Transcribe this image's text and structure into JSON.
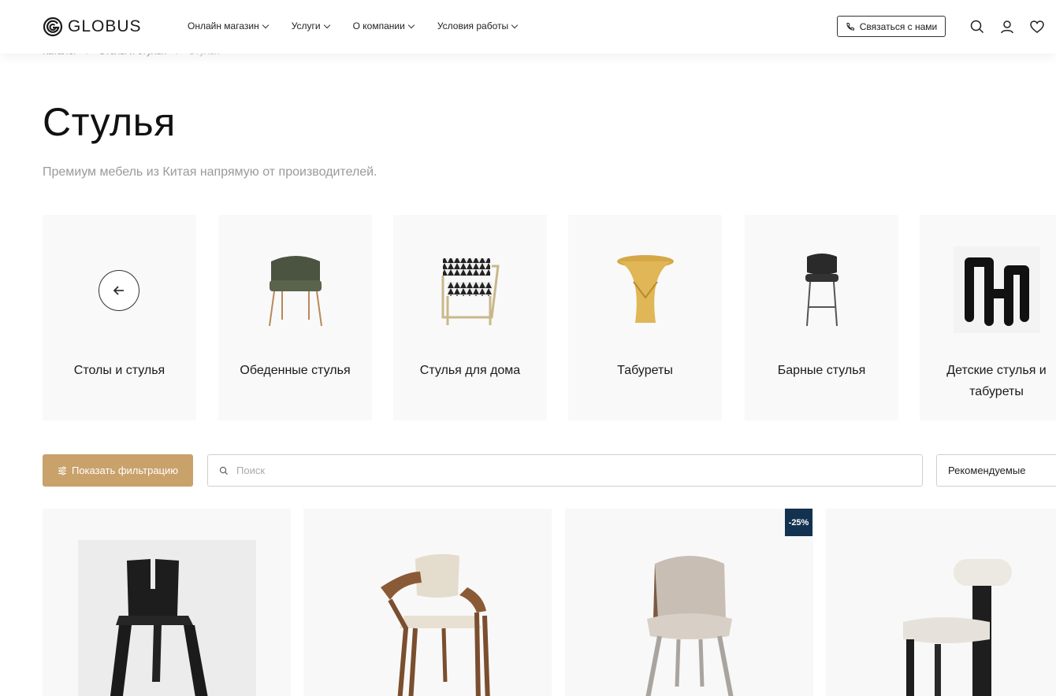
{
  "header": {
    "logo_text": "GLOBUS",
    "nav": [
      "Онлайн магазин",
      "Услуги",
      "О компании",
      "Условия работы"
    ],
    "contact_label": "Связаться с нами"
  },
  "breadcrumb": [
    "Каталог",
    "Столы и стулья",
    "Стулья"
  ],
  "page": {
    "title": "Стулья",
    "subtitle": "Премиум мебель из Китая напрямую от производителей."
  },
  "categories": [
    {
      "label": "Столы и стулья",
      "icon": "arrow-left-icon"
    },
    {
      "label": "Обеденные стулья"
    },
    {
      "label": "Стулья для дома"
    },
    {
      "label": "Табуреты"
    },
    {
      "label": "Барные стулья"
    },
    {
      "label": "Детские стулья и табуреты"
    }
  ],
  "filters": {
    "filter_button": "Показать фильтрацию",
    "search_placeholder": "Поиск",
    "sort_selected": "Рекомендуемые"
  },
  "products": [
    {
      "name": "black-chair"
    },
    {
      "name": "wooden-armchair"
    },
    {
      "name": "upholstered-chair",
      "badge": "-25%"
    },
    {
      "name": "cushion-back-chair"
    }
  ],
  "colors": {
    "accent": "#c9a16a",
    "badge": "#13324f"
  }
}
